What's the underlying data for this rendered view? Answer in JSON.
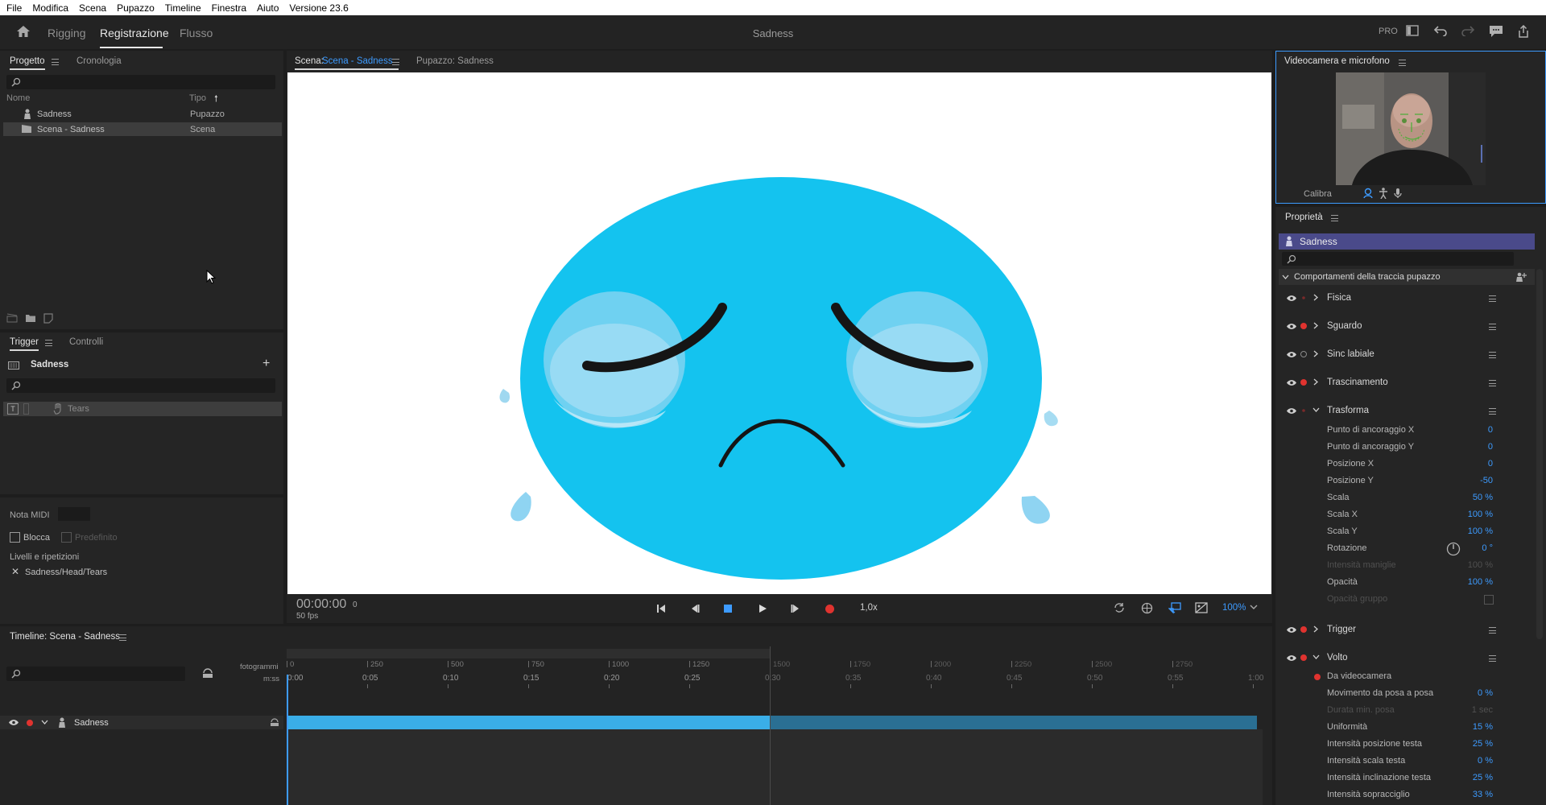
{
  "menubar": [
    "File",
    "Modifica",
    "Scena",
    "Pupazzo",
    "Timeline",
    "Finestra",
    "Aiuto",
    "Versione 23.6"
  ],
  "header": {
    "workspaces": [
      "Rigging",
      "Registrazione",
      "Flusso"
    ],
    "title": "Sadness",
    "pro_label": "PRO"
  },
  "project": {
    "tabs": [
      "Progetto",
      "Cronologia"
    ],
    "col_name": "Nome",
    "col_type": "Tipo",
    "rows": [
      {
        "name": "Sadness",
        "type": "Pupazzo"
      },
      {
        "name": "Scena - Sadness",
        "type": "Scena"
      }
    ]
  },
  "triggers": {
    "tabs": [
      "Trigger",
      "Controlli"
    ],
    "puppet": "Sadness",
    "items": [
      "Tears"
    ],
    "midi_label": "Nota MIDI",
    "lock_label": "Blocca",
    "default_label": "Predefinito",
    "layers_label": "Livelli e ripetizioni",
    "layer_path": "Sadness/Head/Tears"
  },
  "scene": {
    "tab_prefix": "Scena:",
    "tab_scene": "Scena - Sadness",
    "tab_puppet": "Pupazzo: Sadness",
    "timecode": "00:00:00",
    "frame": "0",
    "fps": "50 fps",
    "speed": "1,0x",
    "zoom": "100%"
  },
  "camera": {
    "title": "Videocamera e microfono",
    "calibrate": "Calibra"
  },
  "properties": {
    "title": "Proprietà",
    "puppet": "Sadness",
    "section": "Comportamenti della traccia pupazzo",
    "behaviors_top": [
      "Fisica",
      "Sguardo",
      "Sinc labiale",
      "Trascinamento",
      "Trasforma"
    ],
    "transform": [
      {
        "label": "Punto di ancoraggio X",
        "value": "0"
      },
      {
        "label": "Punto di ancoraggio Y",
        "value": "0"
      },
      {
        "label": "Posizione X",
        "value": "0"
      },
      {
        "label": "Posizione Y",
        "value": "-50"
      },
      {
        "label": "Scala",
        "value": "50 %"
      },
      {
        "label": "Scala X",
        "value": "100 %"
      },
      {
        "label": "Scala Y",
        "value": "100 %"
      },
      {
        "label": "Rotazione",
        "value": "0 °"
      },
      {
        "label": "Intensità maniglie",
        "value": "100 %"
      },
      {
        "label": "Opacità",
        "value": "100 %"
      },
      {
        "label": "Opacità gruppo",
        "value": ""
      }
    ],
    "trigger_label": "Trigger",
    "face_label": "Volto",
    "face_source": "Da videocamera",
    "face": [
      {
        "label": "Movimento da posa a posa",
        "value": "0 %"
      },
      {
        "label": "Durata min. posa",
        "value": "1 sec"
      },
      {
        "label": "Uniformità",
        "value": "15 %"
      },
      {
        "label": "Intensità posizione testa",
        "value": "25 %"
      },
      {
        "label": "Intensità scala testa",
        "value": "0 %"
      },
      {
        "label": "Intensità inclinazione testa",
        "value": "25 %"
      },
      {
        "label": "Intensità sopracciglio",
        "value": "33 %"
      }
    ]
  },
  "timeline": {
    "title": "Timeline: Scena - Sadness",
    "frames_label": "fotogrammi",
    "mss_label": "m:ss",
    "frame_ticks": [
      "0",
      "250",
      "500",
      "750",
      "1000",
      "1250",
      "1500",
      "1750",
      "2000",
      "2250",
      "2500",
      "2750"
    ],
    "time_ticks": [
      "0:00",
      "0:05",
      "0:10",
      "0:15",
      "0:20",
      "0:25",
      "0:30",
      "0:35",
      "0:40",
      "0:45",
      "0:50",
      "0:55",
      "1:00"
    ],
    "track": "Sadness"
  },
  "colors": {
    "accent": "#3d9bff",
    "face": "#14c3ef",
    "track_bar": "#3aaee8",
    "record": "#e0332f",
    "puppet_header": "#4a4a8a"
  }
}
